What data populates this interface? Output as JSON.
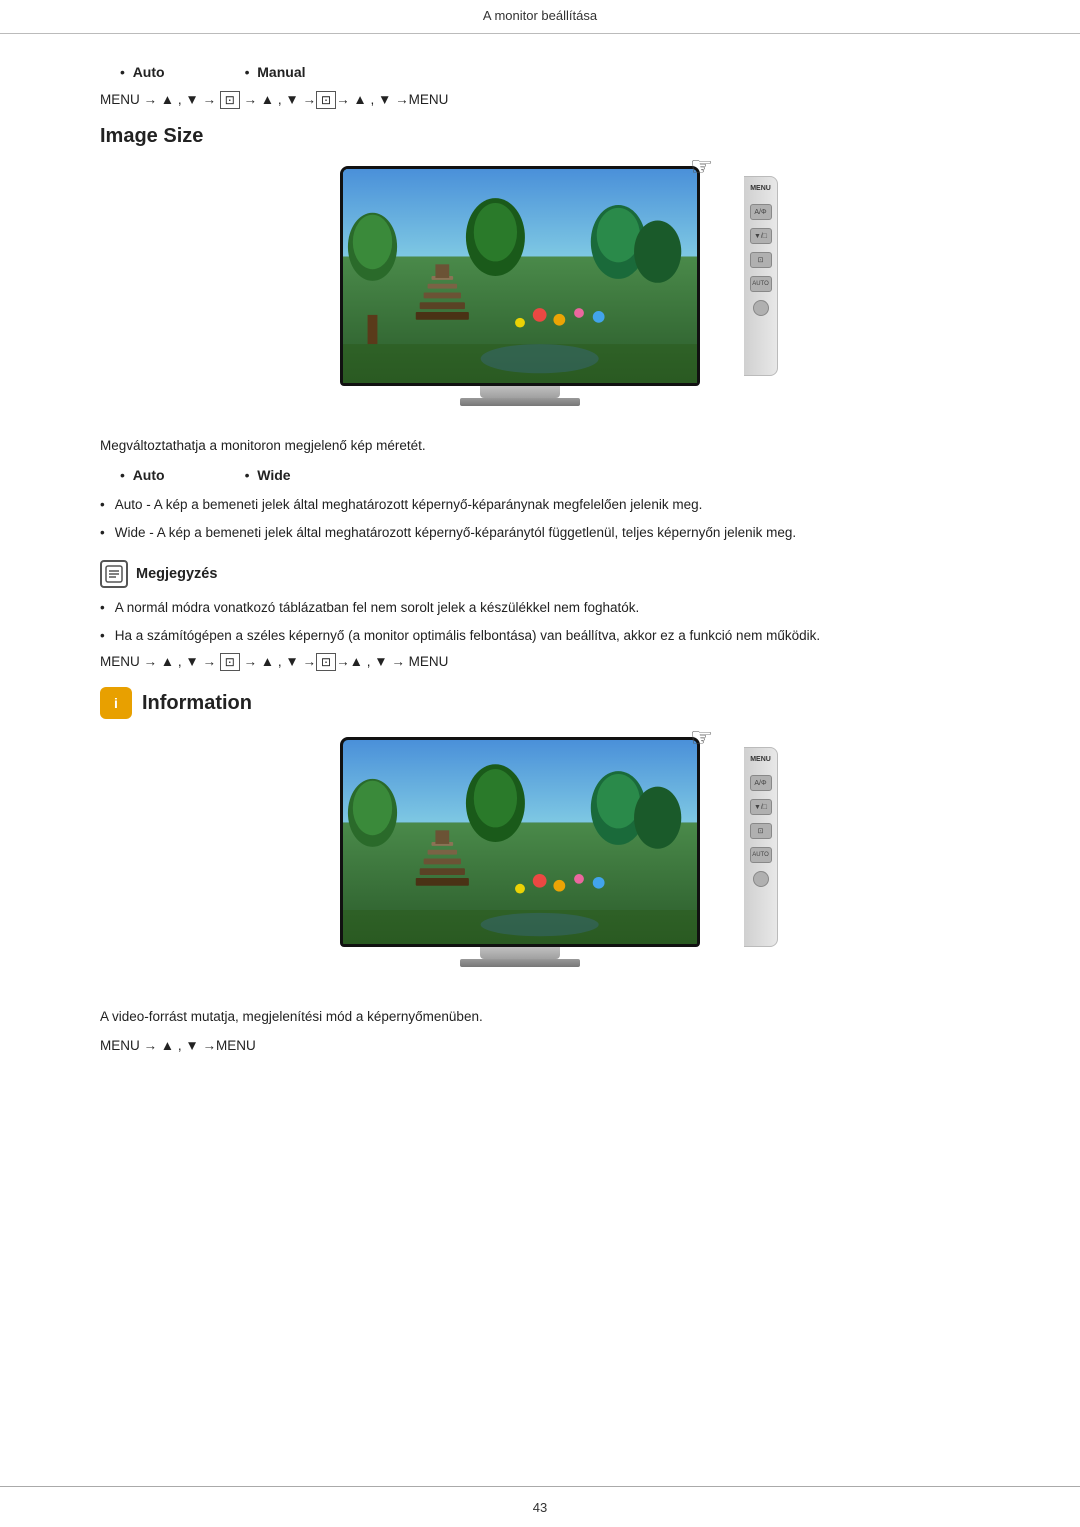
{
  "page": {
    "header": "A monitor beállítása",
    "page_number": "43"
  },
  "section1": {
    "bullet1_label": "Auto",
    "bullet2_label": "Manual",
    "menu_line": "MENU → ▲ , ▼ → ⊡ → ▲ , ▼ →⊡ → ▲ , ▼ →MENU"
  },
  "image_size_section": {
    "title": "Image Size",
    "description": "Megváltoztathatja a monitoron megjelenő kép méretét.",
    "bullet1_label": "Auto",
    "bullet2_label": "Wide",
    "auto_desc": "Auto - A kép a bemeneti jelek által meghatározott képernyő-képaránynak megfelelően jelenik meg.",
    "wide_desc": "Wide - A kép a bemeneti jelek által meghatározott képernyő-képaránytól függetlenül, teljes képernyőn jelenik meg.",
    "note_title": "Megjegyzés",
    "note_items": [
      "A normál módra vonatkozó táblázatban fel nem sorolt jelek a készülékkel nem foghatók.",
      "Ha a számítógépen a széles képernyő (a monitor optimális felbontása) van beállítva, akkor ez a funkció nem működik."
    ],
    "menu_line2": "MENU → ▲ , ▼ → ⊡ → ▲ , ▼ →⊡ →▲ , ▼ → MENU"
  },
  "information_section": {
    "title": "Information",
    "description": "A video-forrást mutatja, megjelenítési mód a képernyőmenüben.",
    "menu_line": "MENU → ▲ , ▼ →MENU"
  },
  "monitor_side_buttons": [
    "MENU",
    "A/Φ",
    "▼/□",
    "⊡",
    "AUTO",
    "⏻"
  ]
}
